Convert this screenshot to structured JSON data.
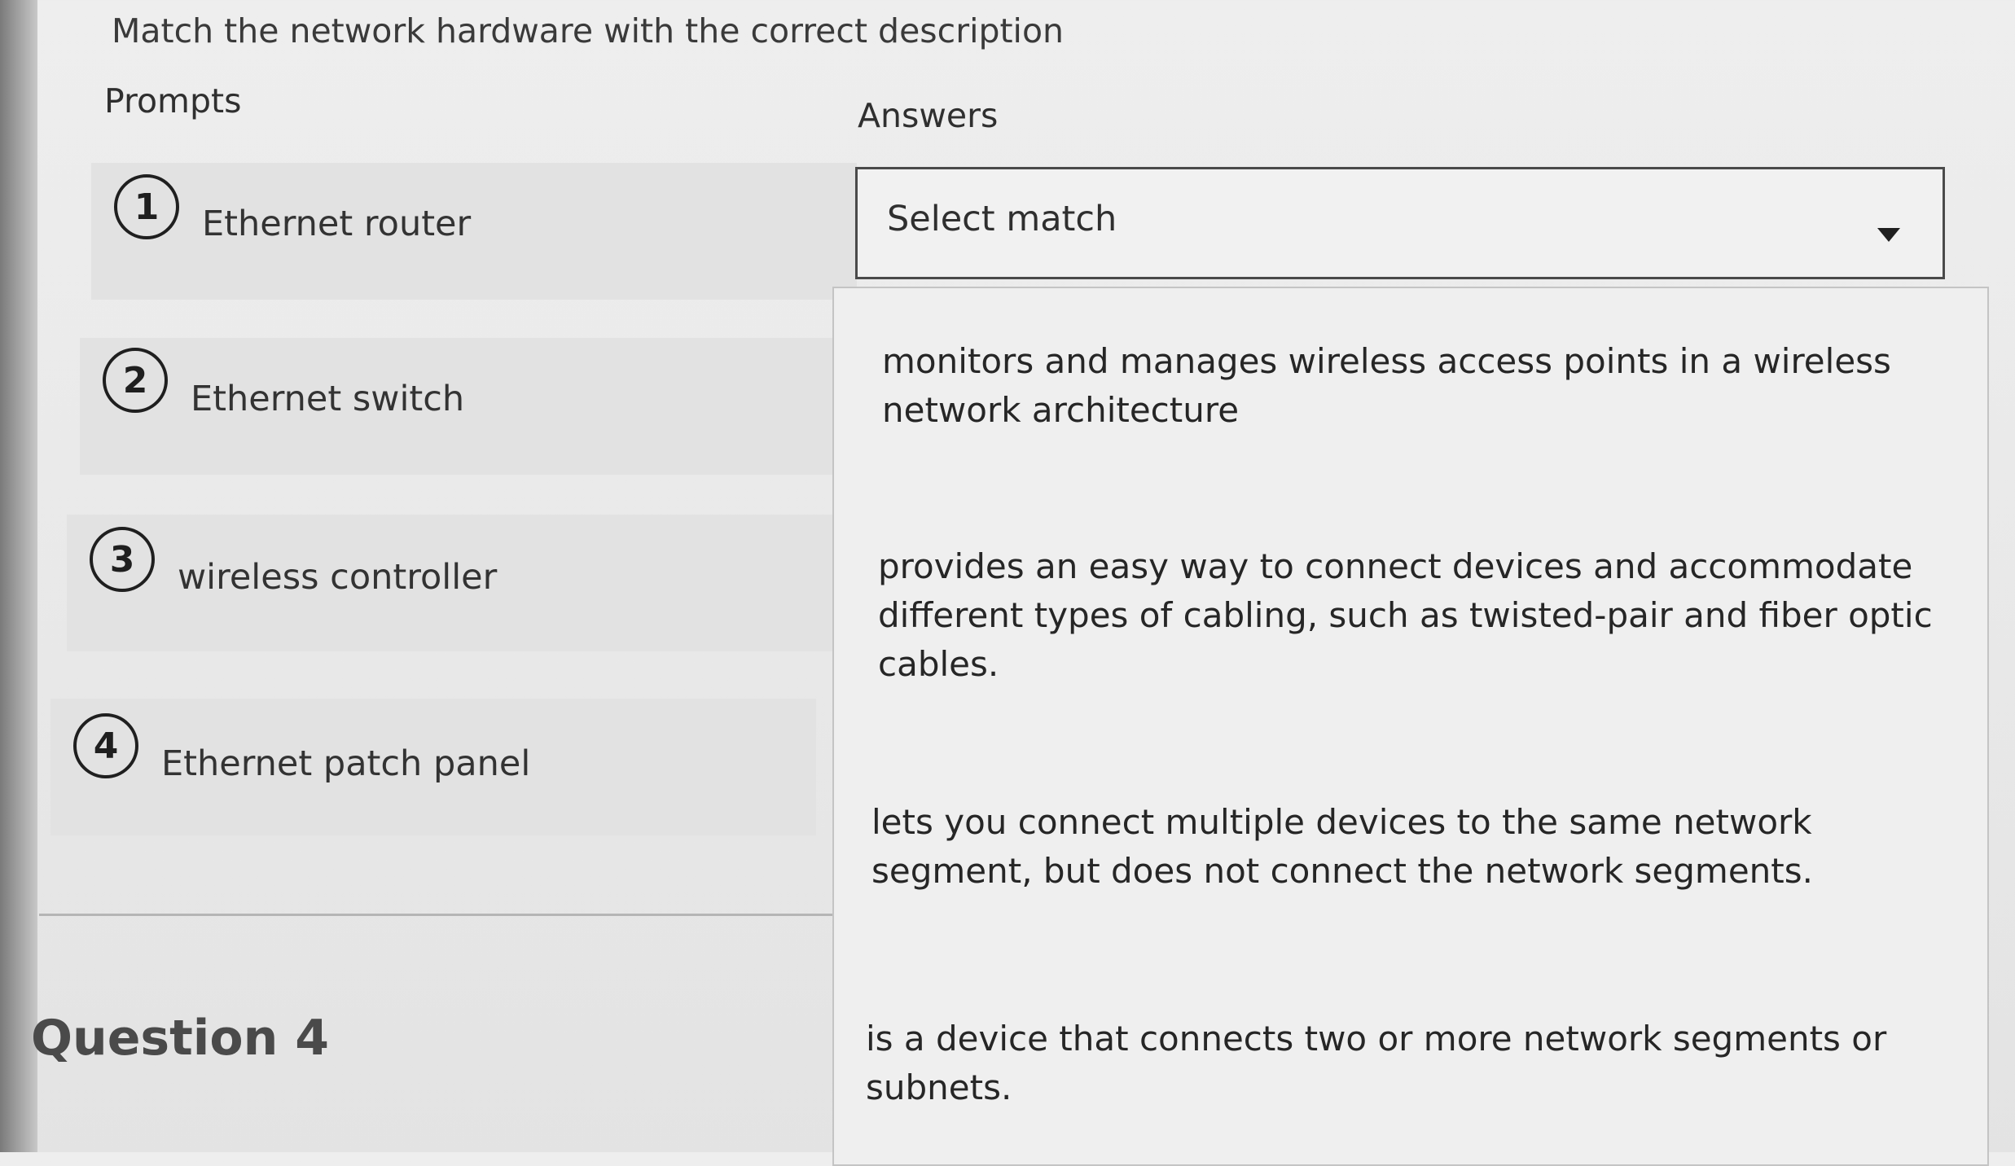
{
  "instruction": "Match the network hardware with the correct description",
  "headers": {
    "prompts": "Prompts",
    "answers": "Answers"
  },
  "prompts": [
    {
      "number": "1",
      "label": "Ethernet router"
    },
    {
      "number": "2",
      "label": "Ethernet switch"
    },
    {
      "number": "3",
      "label": "wireless controller"
    },
    {
      "number": "4",
      "label": "Ethernet patch panel"
    }
  ],
  "select": {
    "value": "Select match",
    "caret_icon": "caret-down-icon"
  },
  "options": [
    "monitors and manages wireless access points in a wireless network architecture",
    "provides an easy way to connect devices and accommodate different types of cabling, such as twisted-pair and fiber optic cables.",
    "lets you connect multiple devices to the same network segment, but does not connect the network segments.",
    "is a device that connects two or more network segments or subnets."
  ],
  "next_question": "Question 4"
}
